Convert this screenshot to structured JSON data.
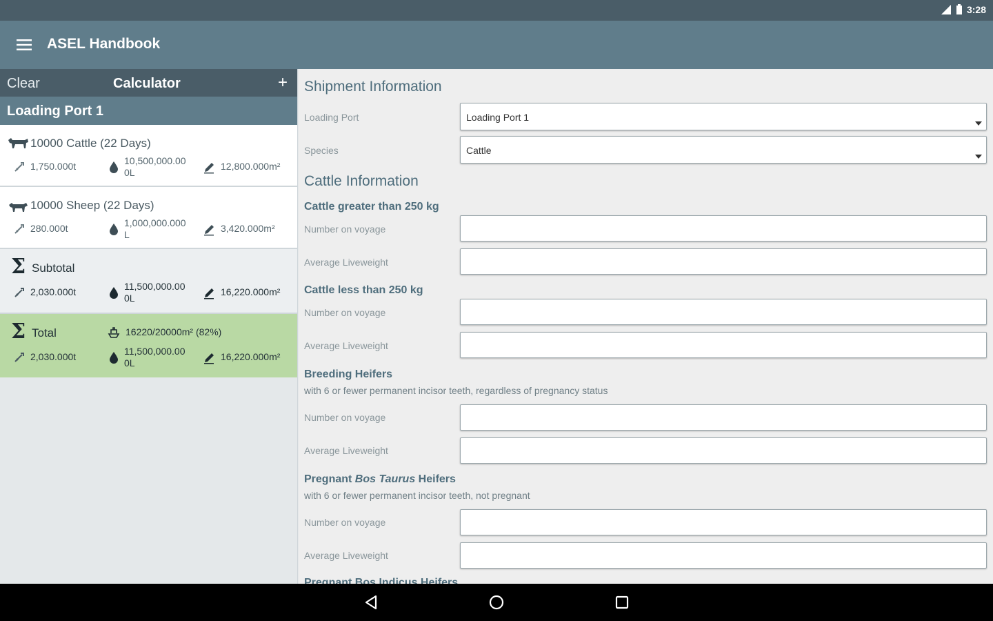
{
  "status_bar": {
    "time": "3:28",
    "icons": [
      "signal-icon",
      "battery-icon"
    ]
  },
  "app_bar": {
    "title": "ASEL Handbook",
    "menu_icon": "menu-icon"
  },
  "calculator": {
    "clear_label": "Clear",
    "title": "Calculator",
    "add_label": "+",
    "port_name": "Loading Port 1",
    "cattle": {
      "title": "10000 Cattle (22 Days)",
      "feed": "1,750.000t",
      "water": "10,500,000.00\n0L",
      "area": "12,800.000m²"
    },
    "sheep": {
      "title": "10000 Sheep (22 Days)",
      "feed": "280.000t",
      "water": "1,000,000.000\nL",
      "area": "3,420.000m²"
    },
    "subtotal": {
      "title": "Subtotal",
      "feed": "2,030.000t",
      "water": "11,500,000.00\n0L",
      "area": "16,220.000m²"
    },
    "total": {
      "title": "Total",
      "capacity": "16220/20000m² (82%)",
      "feed": "2,030.000t",
      "water": "11,500,000.00\n0L",
      "area": "16,220.000m²"
    }
  },
  "form": {
    "shipment_title": "Shipment Information",
    "loading_port_label": "Loading Port",
    "loading_port_value": "Loading Port 1",
    "species_label": "Species",
    "species_value": "Cattle",
    "cattle_info_title": "Cattle Information",
    "groups": [
      {
        "title": "Cattle greater than 250 kg",
        "note": "",
        "number_label": "Number on voyage",
        "weight_label": "Average Liveweight"
      },
      {
        "title": "Cattle less than 250 kg",
        "note": "",
        "number_label": "Number on voyage",
        "weight_label": "Average Liveweight"
      },
      {
        "title": "Breeding Heifers",
        "note": "with 6 or fewer permanent incisor teeth, regardless of pregnancy status",
        "number_label": "Number on voyage",
        "weight_label": "Average Liveweight"
      },
      {
        "title_prefix": "Pregnant ",
        "title_italic": "Bos Taurus",
        "title_suffix": " Heifers",
        "note": "with 6 or fewer permanent incisor teeth, not pregnant",
        "number_label": "Number on voyage",
        "weight_label": "Average Liveweight"
      },
      {
        "title": "Pregnant Bos Indicus Heifers"
      }
    ]
  },
  "colors": {
    "status_bar": "#4a5d68",
    "app_bar": "#607d8b",
    "total_row": "#b9d9a4",
    "heading": "#4e6d7c"
  }
}
